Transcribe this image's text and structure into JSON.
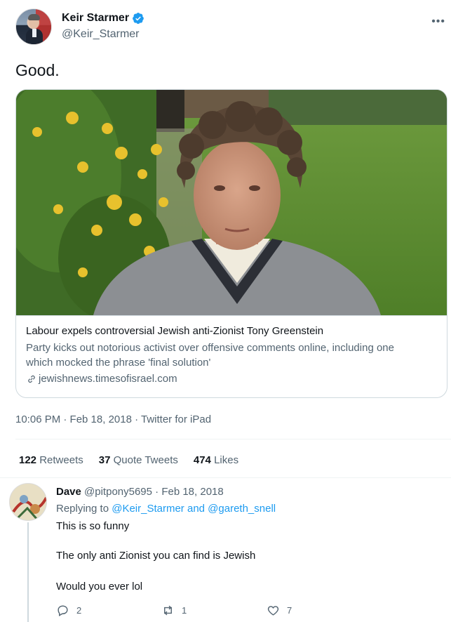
{
  "tweet": {
    "display_name": "Keir Starmer",
    "handle": "@Keir_Starmer",
    "text": "Good.",
    "card": {
      "title": "Labour expels controversial Jewish anti-Zionist Tony Greenstein",
      "description_line1": "Party kicks out notorious activist over offensive comments online, including one",
      "description_line2": "which mocked the phrase 'final solution'",
      "domain": "jewishnews.timesofisrael.com"
    },
    "timestamp": "10:06 PM · Feb 18, 2018 · Twitter for iPad",
    "stats": [
      {
        "count": "122",
        "label": "Retweets"
      },
      {
        "count": "37",
        "label": "Quote Tweets"
      },
      {
        "count": "474",
        "label": "Likes"
      }
    ]
  },
  "reply": {
    "name": "Dave",
    "handle_date": "@pitpony5695 · Feb 18, 2018",
    "replying_prefix": "Replying to",
    "replying_mentions": "@Keir_Starmer and @gareth_snell",
    "lines": [
      "This is so funny",
      "The only anti Zionist you can find is Jewish",
      "Would you ever lol"
    ],
    "actions": {
      "reply_count": "2",
      "retweet_count": "1",
      "like_count": "7"
    }
  },
  "colors": {
    "accent": "#1d9bf0",
    "text": "#0f1419",
    "muted": "#536471",
    "border": "#cfd9de"
  },
  "icons": [
    "verified-icon",
    "more-icon",
    "link-icon",
    "reply-icon",
    "retweet-icon",
    "like-icon"
  ]
}
